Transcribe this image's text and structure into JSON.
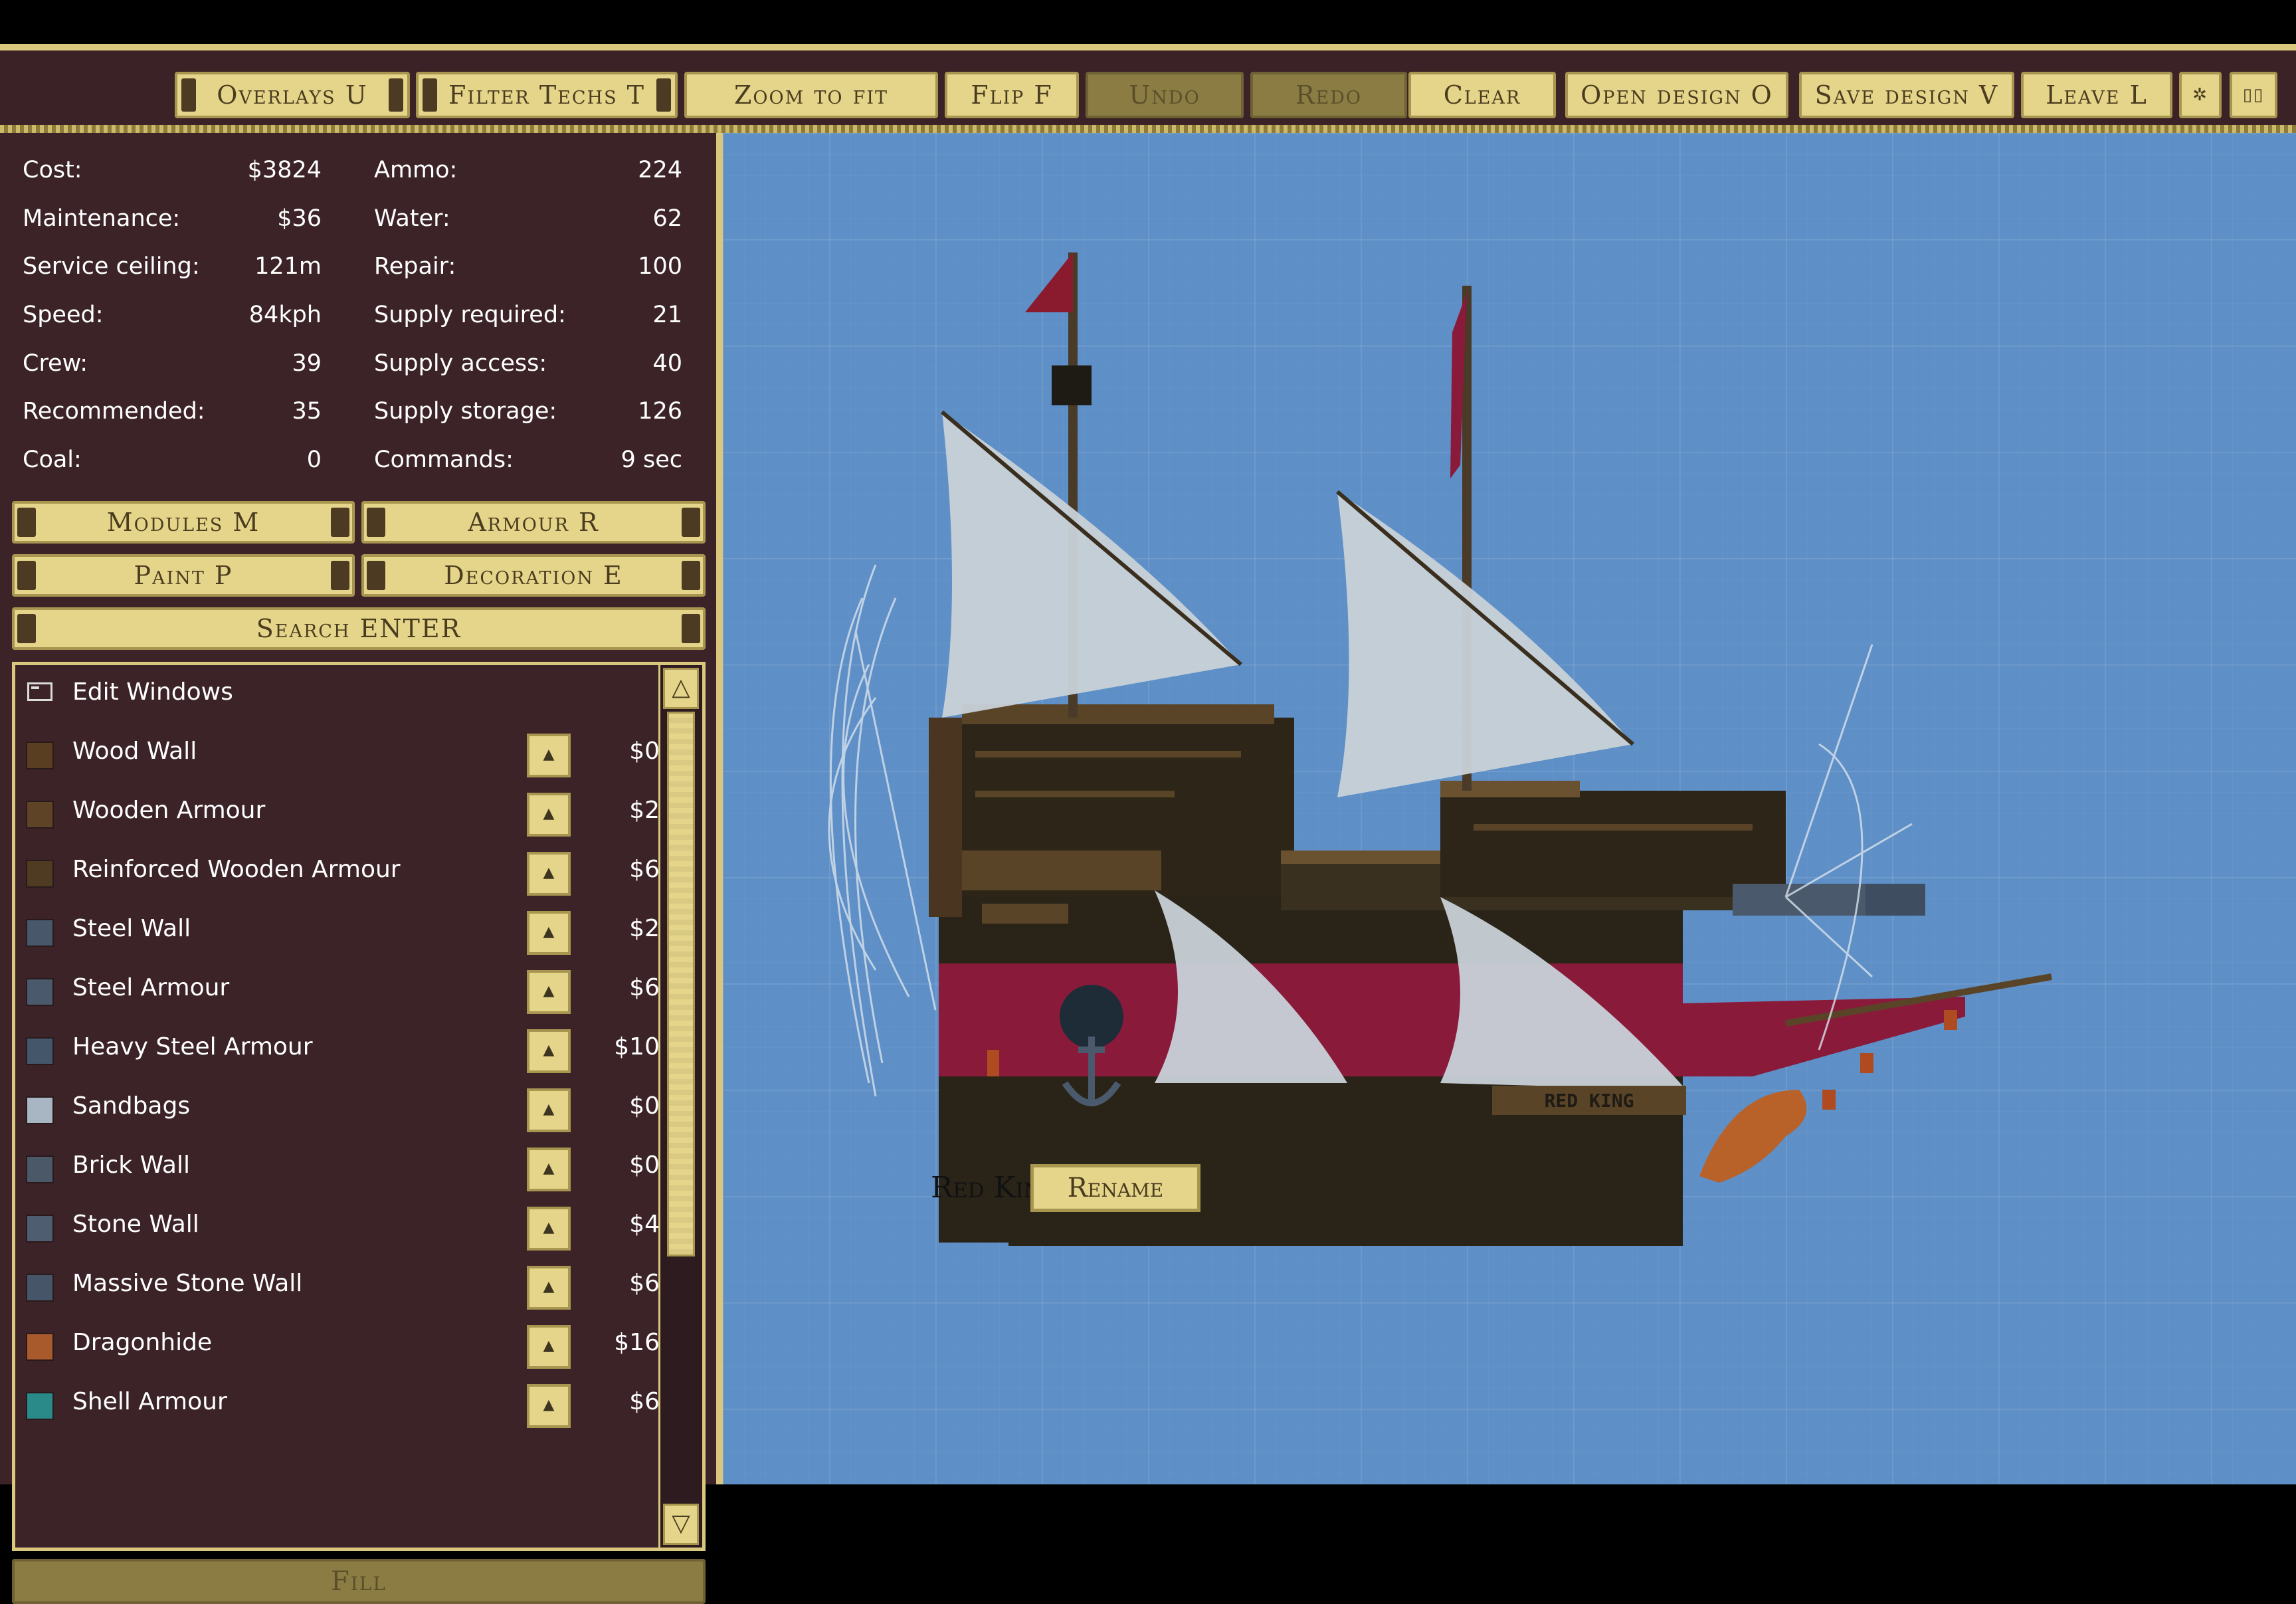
{
  "toolbar": {
    "overlays": "Overlays U",
    "filter_techs": "Filter Techs T",
    "zoom_to_fit": "Zoom to fit",
    "flip": "Flip F",
    "undo": "Undo",
    "redo": "Redo",
    "clear": "Clear",
    "open_design": "Open design O",
    "save_design": "Save design V",
    "leave": "Leave L",
    "settings_icon": "gear-icon",
    "book_icon": "book-icon"
  },
  "stats": {
    "left": [
      {
        "label": "Cost:",
        "value": "$3824"
      },
      {
        "label": "Maintenance:",
        "value": "$36"
      },
      {
        "label": "Service ceiling:",
        "value": "121m"
      },
      {
        "label": "Speed:",
        "value": "84kph"
      },
      {
        "label": "Crew:",
        "value": "39"
      },
      {
        "label": "Recommended:",
        "value": "35"
      },
      {
        "label": "Coal:",
        "value": "0"
      }
    ],
    "right": [
      {
        "label": "Ammo:",
        "value": "224"
      },
      {
        "label": "Water:",
        "value": "62"
      },
      {
        "label": "Repair:",
        "value": "100"
      },
      {
        "label": "Supply required:",
        "value": "21"
      },
      {
        "label": "Supply access:",
        "value": "40"
      },
      {
        "label": "Supply storage:",
        "value": "126"
      },
      {
        "label": "Commands:",
        "value": "9 sec"
      }
    ]
  },
  "categories": {
    "modules": "Modules M",
    "armour": "Armour R",
    "paint": "Paint P",
    "decoration": "Decoration E",
    "search": "Search ENTER"
  },
  "list": {
    "header": "Edit Windows",
    "items": [
      {
        "name": "Wood Wall",
        "price": "$0",
        "color": "#5a3e22"
      },
      {
        "name": "Wooden Armour",
        "price": "$2",
        "color": "#5e4326"
      },
      {
        "name": "Reinforced Wooden Armour",
        "price": "$6",
        "color": "#4f3a22"
      },
      {
        "name": "Steel Wall",
        "price": "$2",
        "color": "#48586a"
      },
      {
        "name": "Steel Armour",
        "price": "$6",
        "color": "#4a5a6c"
      },
      {
        "name": "Heavy Steel Armour",
        "price": "$10",
        "color": "#44566a"
      },
      {
        "name": "Sandbags",
        "price": "$0",
        "color": "#a8b6c4"
      },
      {
        "name": "Brick Wall",
        "price": "$0",
        "color": "#4a5868"
      },
      {
        "name": "Stone Wall",
        "price": "$4",
        "color": "#4e5e70"
      },
      {
        "name": "Massive Stone Wall",
        "price": "$6",
        "color": "#465668"
      },
      {
        "name": "Dragonhide",
        "price": "$16",
        "color": "#a85a2c"
      },
      {
        "name": "Shell Armour",
        "price": "$6",
        "color": "#2a8a8a"
      }
    ]
  },
  "fill_button": "Fill",
  "ship": {
    "name": "Red King",
    "rename_label": "Rename",
    "hull_plate": "RED KING"
  },
  "colors": {
    "panel_bg": "#3b2328",
    "button_gold": "#e5d58a",
    "canvas_blue": "#5e8fc6",
    "hull_red": "#8a1a3a",
    "hull_dark": "#2a2418"
  }
}
